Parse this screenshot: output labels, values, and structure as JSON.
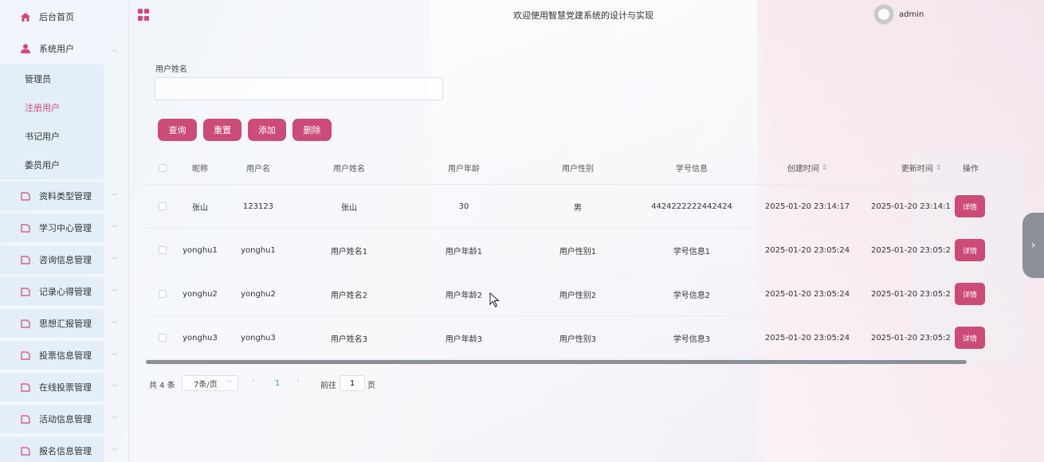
{
  "header": {
    "title": "欢迎使用智慧党建系统的设计与实现",
    "username": "admin"
  },
  "sidebar": {
    "home": "后台首页",
    "system_users": "系统用户",
    "sub_items": [
      "管理员",
      "注册用户",
      "书记用户",
      "委员用户"
    ],
    "groups": [
      "资料类型管理",
      "学习中心管理",
      "咨询信息管理",
      "记录心得管理",
      "思想汇报管理",
      "投票信息管理",
      "在线投票管理",
      "活动信息管理",
      "报名信息管理"
    ]
  },
  "search": {
    "label": "用户姓名",
    "value": "",
    "placeholder": ""
  },
  "buttons": {
    "query": "查询",
    "reset": "重置",
    "add": "添加",
    "delete": "删除"
  },
  "table": {
    "headers": [
      "昵称",
      "用户名",
      "用户姓名",
      "用户年龄",
      "用户性别",
      "学号信息",
      "创建时间",
      "更新时间",
      "操作"
    ],
    "rows": [
      {
        "nickname": "张山",
        "username": "123123",
        "name": "张山",
        "age": "30",
        "gender": "男",
        "student_id": "4424222222442424",
        "created": "2025-01-20 23:14:17",
        "updated": "2025-01-20 23:14:1",
        "action": "详情"
      },
      {
        "nickname": "yonghu1",
        "username": "yonghu1",
        "name": "用户姓名1",
        "age": "用户年龄1",
        "gender": "用户性别1",
        "student_id": "学号信息1",
        "created": "2025-01-20 23:05:24",
        "updated": "2025-01-20 23:05:2",
        "action": "详情"
      },
      {
        "nickname": "yonghu2",
        "username": "yonghu2",
        "name": "用户姓名2",
        "age": "用户年龄2",
        "gender": "用户性别2",
        "student_id": "学号信息2",
        "created": "2025-01-20 23:05:24",
        "updated": "2025-01-20 23:05:2",
        "action": "详情"
      },
      {
        "nickname": "yonghu3",
        "username": "yonghu3",
        "name": "用户姓名3",
        "age": "用户年龄3",
        "gender": "用户性别3",
        "student_id": "学号信息3",
        "created": "2025-01-20 23:05:24",
        "updated": "2025-01-20 23:05:2",
        "action": "详情"
      }
    ]
  },
  "pagination": {
    "total": "共 4 条",
    "page_size": "7条/页",
    "current": "1",
    "goto_label": "前往",
    "goto_value": "1",
    "page_suffix": "页"
  },
  "colors": {
    "accent": "#cc4b78"
  }
}
